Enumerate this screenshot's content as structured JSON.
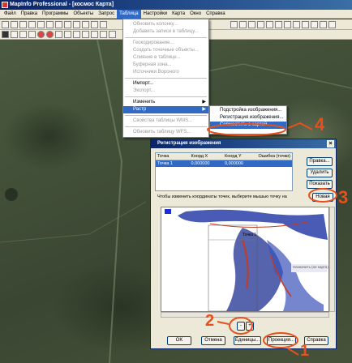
{
  "window": {
    "title": "MapInfo Professional - [космос Карта]"
  },
  "menubar": [
    "Файл",
    "Правка",
    "Программы",
    "Объекты",
    "Запрос",
    "Таблица",
    "Настройки",
    "Карта",
    "Окно",
    "Справка"
  ],
  "table_menu": {
    "items": [
      {
        "label": "Обновить колонку...",
        "enabled": false
      },
      {
        "label": "Добавить записи в таблицу...",
        "enabled": false
      },
      {
        "sep": true
      },
      {
        "label": "Геокодирование...",
        "enabled": false
      },
      {
        "label": "Создать точечные объекты...",
        "enabled": false
      },
      {
        "label": "Слияние в таблице...",
        "enabled": false
      },
      {
        "label": "Буферная зона...",
        "enabled": false
      },
      {
        "label": "Источники Вороного",
        "enabled": false
      },
      {
        "sep": true
      },
      {
        "label": "Импорт...",
        "enabled": true
      },
      {
        "label": "Экспорт...",
        "enabled": false
      },
      {
        "sep": true
      },
      {
        "label": "Изменить",
        "enabled": true,
        "submenu": true
      },
      {
        "label": "Растр",
        "enabled": true,
        "submenu": true,
        "selected": true
      },
      {
        "sep": true
      },
      {
        "label": "Свойства таблицы WMS...",
        "enabled": false
      },
      {
        "sep": true
      },
      {
        "label": "Обновить таблицу WFS...",
        "enabled": false
      }
    ]
  },
  "raster_submenu": [
    {
      "label": "Подстройка изображения...",
      "selected": false
    },
    {
      "label": "Регистрация изображения...",
      "selected": false
    },
    {
      "label": "Совместить с картой",
      "selected": true
    }
  ],
  "dialog": {
    "title": "Регистрация изображения",
    "columns": [
      "Точка",
      "Коорд X",
      "Коорд Y",
      "Ошибка (точки)"
    ],
    "rows": [
      [
        "Точка 1",
        "0,000000",
        "0,000000",
        ""
      ]
    ],
    "side_buttons": {
      "edit": "Правка...",
      "delete": "Удалить",
      "show": "Показать"
    },
    "hint": "Чтобы изменить координаты точек, выберите мышью точку на",
    "new_button": "Новая",
    "point_label": "Точка 1",
    "status": "Назначить (не карта)",
    "zoom_minus": "-",
    "zoom_plus": "+",
    "bottom_buttons": {
      "ok": "OK",
      "cancel": "Отмена",
      "units": "Единицы...",
      "projection": "Проекция...",
      "help": "Справка"
    }
  },
  "annotations": {
    "a1": "1",
    "a2": "2",
    "a3": "3",
    "a4": "4"
  },
  "colors": {
    "annotation": "#e8501b",
    "selection": "#316ac5"
  }
}
